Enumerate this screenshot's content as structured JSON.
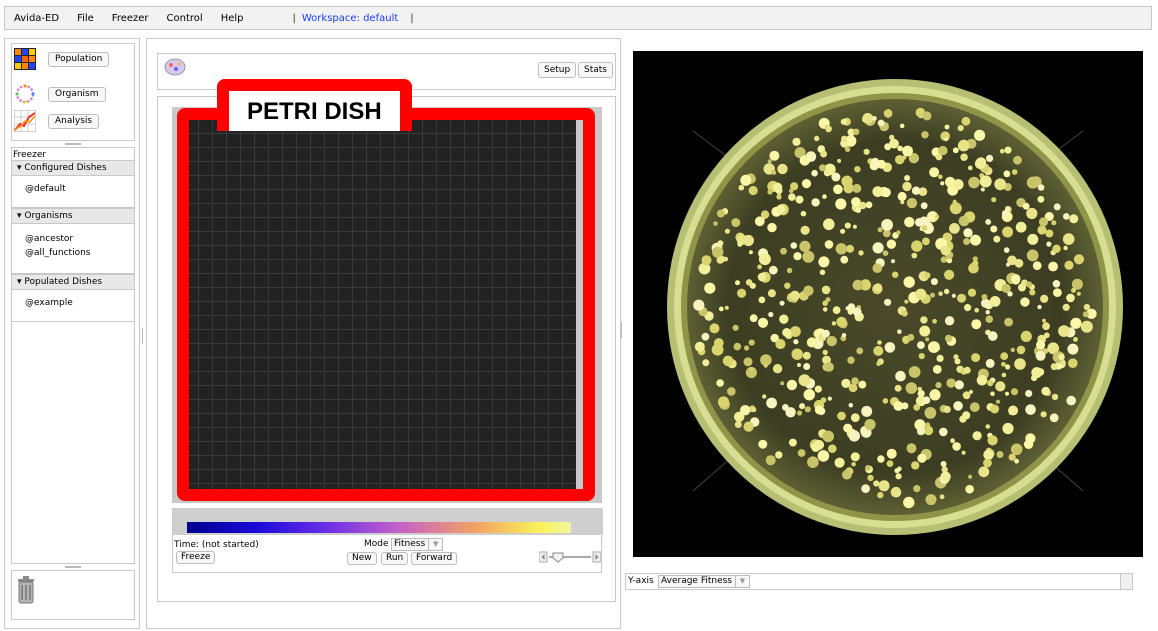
{
  "menu": {
    "app": "Avida-ED",
    "items": [
      "File",
      "Freezer",
      "Control",
      "Help"
    ],
    "separator_left": "|",
    "workspace": "Workspace: default",
    "separator_right": "|"
  },
  "nav": {
    "population": "Population",
    "organism": "Organism",
    "analysis": "Analysis"
  },
  "freezer": {
    "title": "Freezer",
    "sections": [
      {
        "label": "▾ Configured Dishes",
        "items": [
          "@default"
        ]
      },
      {
        "label": "▾ Organisms",
        "items": [
          "@ancestor",
          "@all_functions"
        ]
      },
      {
        "label": "▾ Populated Dishes",
        "items": [
          "@example"
        ]
      }
    ]
  },
  "dish": {
    "setup": "Setup",
    "stats": "Stats",
    "overlay_label": "PETRI DISH"
  },
  "controls": {
    "time": "Time: (not started)",
    "freeze": "Freeze",
    "mode_label": "Mode",
    "mode_value": "Fitness",
    "new": "New",
    "run": "Run",
    "forward": "Forward"
  },
  "graph": {
    "yaxis_label": "Y-axis",
    "yaxis_value": "Average Fitness"
  },
  "colors": {
    "overlay_red": "#ff0000",
    "workspace_blue": "#1a3cff",
    "grid_cell": "#222222"
  }
}
